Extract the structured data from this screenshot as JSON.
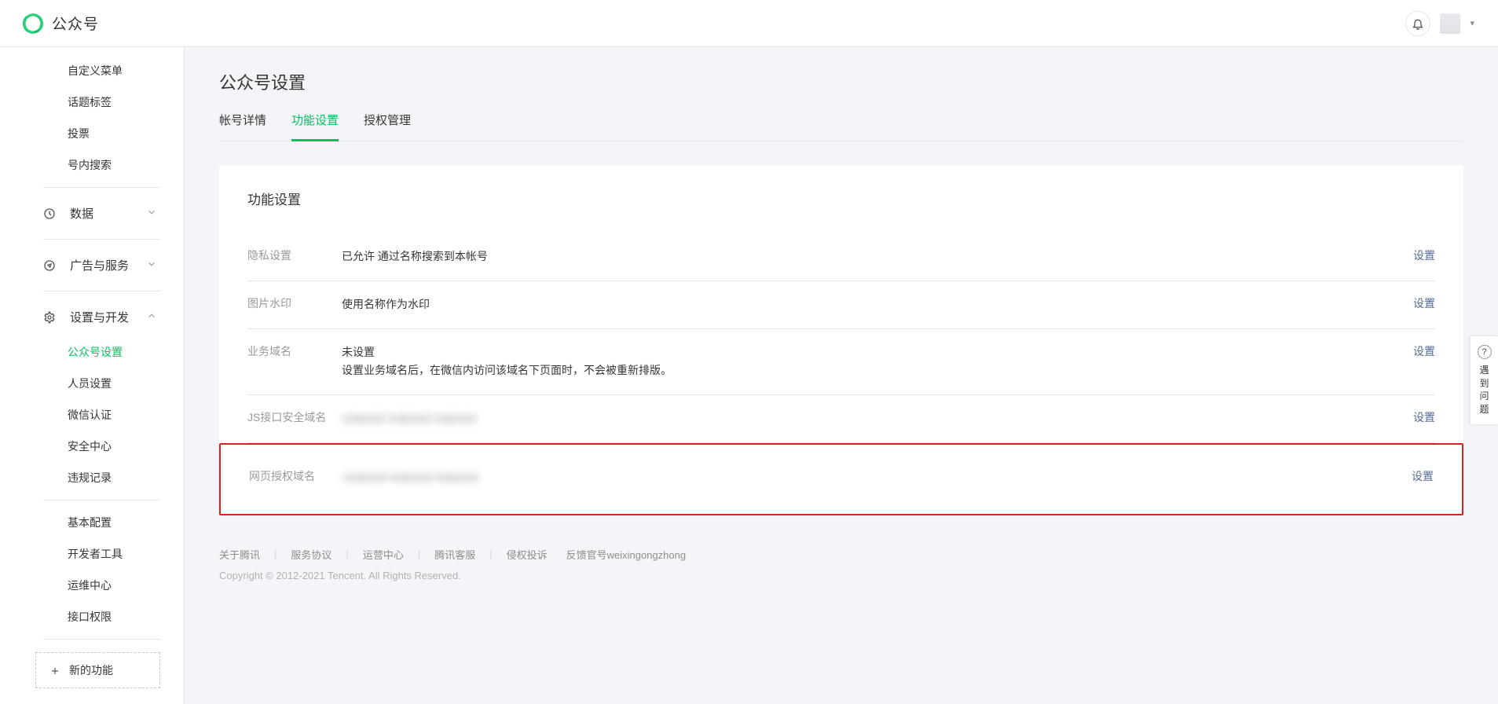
{
  "header": {
    "brand": "公众号"
  },
  "sidebar": {
    "topItems": [
      "自定义菜单",
      "话题标签",
      "投票",
      "号内搜索"
    ],
    "groups": [
      {
        "icon": "clock",
        "label": "数据",
        "expanded": false
      },
      {
        "icon": "compass",
        "label": "广告与服务",
        "expanded": false
      },
      {
        "icon": "gear",
        "label": "设置与开发",
        "expanded": true,
        "children": [
          "公众号设置",
          "人员设置",
          "微信认证",
          "安全中心",
          "违规记录"
        ],
        "children2": [
          "基本配置",
          "开发者工具",
          "运维中心",
          "接口权限"
        ]
      }
    ],
    "activeChild": "公众号设置",
    "newFeature": "新的功能"
  },
  "page": {
    "title": "公众号设置",
    "tabs": [
      "帐号详情",
      "功能设置",
      "授权管理"
    ],
    "activeTab": "功能设置"
  },
  "section": {
    "title": "功能设置",
    "actionLabel": "设置",
    "rows": [
      {
        "label": "隐私设置",
        "value": "已允许 通过名称搜索到本帐号"
      },
      {
        "label": "图片水印",
        "value": "使用名称作为水印"
      },
      {
        "label": "业务域名",
        "value": "未设置",
        "sub": "设置业务域名后，在微信内访问该域名下页面时，不会被重新排版。"
      },
      {
        "label": "JS接口安全域名",
        "value": "redacted redacted redacted",
        "blur": true
      },
      {
        "label": "网页授权域名",
        "value": "redacted redacted redacted",
        "blur": true,
        "highlight": true
      }
    ]
  },
  "footer": {
    "links": [
      "关于腾讯",
      "服务协议",
      "运营中心",
      "腾讯客服",
      "侵权投诉"
    ],
    "feedback": "反馈官号weixingongzhong",
    "copyright": "Copyright © 2012-2021 Tencent. All Rights Reserved."
  },
  "help": {
    "text": "遇到问题"
  }
}
